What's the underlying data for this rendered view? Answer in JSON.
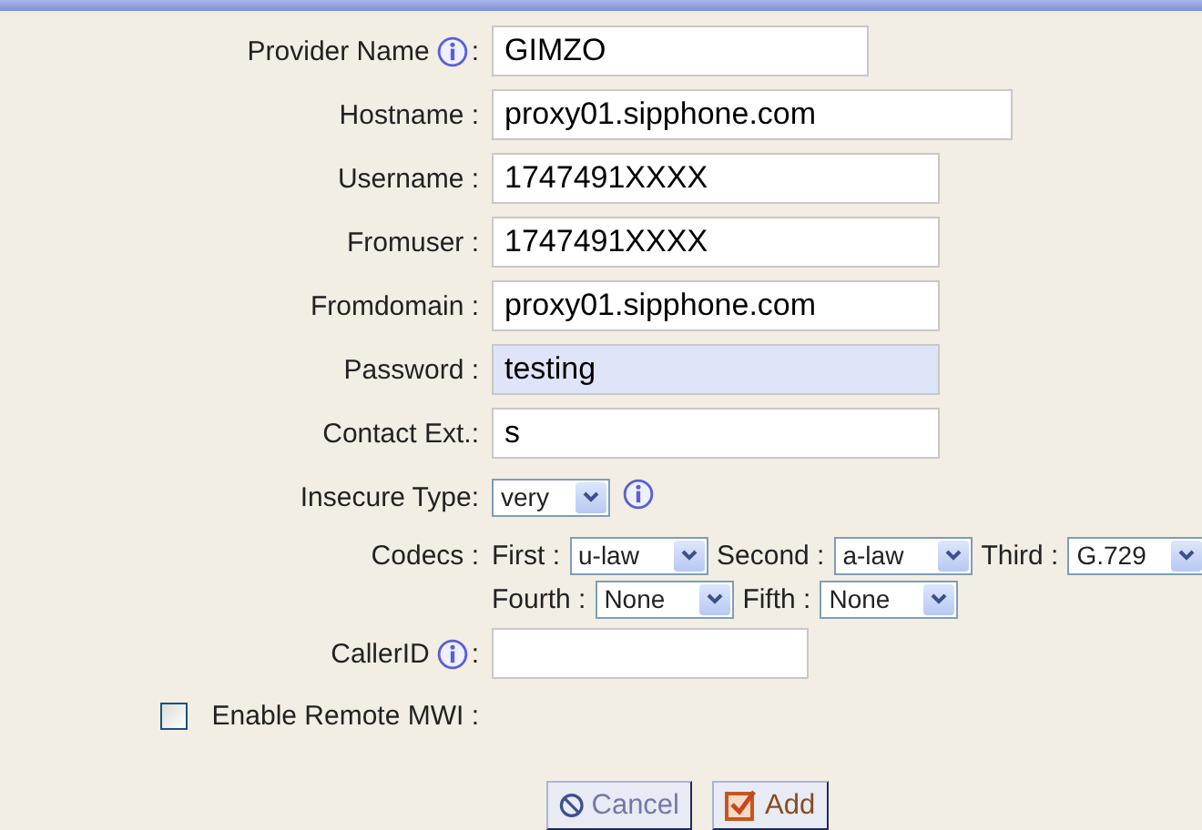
{
  "rows": [
    {
      "kind": "text",
      "label": "Provider Name",
      "info": true,
      "colon": ":",
      "value": "GIMZO"
    },
    {
      "kind": "text",
      "label": "Hostname :",
      "value": "proxy01.sipphone.com"
    },
    {
      "kind": "text",
      "label": "Username :",
      "value": "1747491XXXX"
    },
    {
      "kind": "text",
      "label": "Fromuser :",
      "value": "1747491XXXX"
    },
    {
      "kind": "text",
      "label": "Fromdomain :",
      "value": "proxy01.sipphone.com"
    },
    {
      "kind": "text",
      "label": "Password :",
      "value": "testing",
      "autofilled": true
    },
    {
      "kind": "text",
      "label": "Contact Ext.:",
      "value": "s"
    },
    {
      "kind": "select",
      "label": "Insecure Type:",
      "value": "very",
      "info": true
    },
    {
      "kind": "codecs",
      "label": "Codecs :",
      "lines": [
        [
          {
            "label": "First :",
            "value": "u-law"
          },
          {
            "label": "Second :",
            "value": "a-law"
          },
          {
            "label": "Third :",
            "value": "G.729"
          }
        ],
        [
          {
            "label": "Fourth :",
            "value": "None"
          },
          {
            "label": "Fifth :",
            "value": "None"
          }
        ]
      ]
    },
    {
      "kind": "text",
      "label": "CallerID",
      "info": true,
      "colon": ":"
    },
    {
      "kind": "checkbox",
      "label": "Enable Remote MWI :",
      "checked": false
    }
  ],
  "buttons": [
    {
      "kind": "cancel",
      "label": "Cancel"
    },
    {
      "kind": "add",
      "label": "Add"
    }
  ]
}
